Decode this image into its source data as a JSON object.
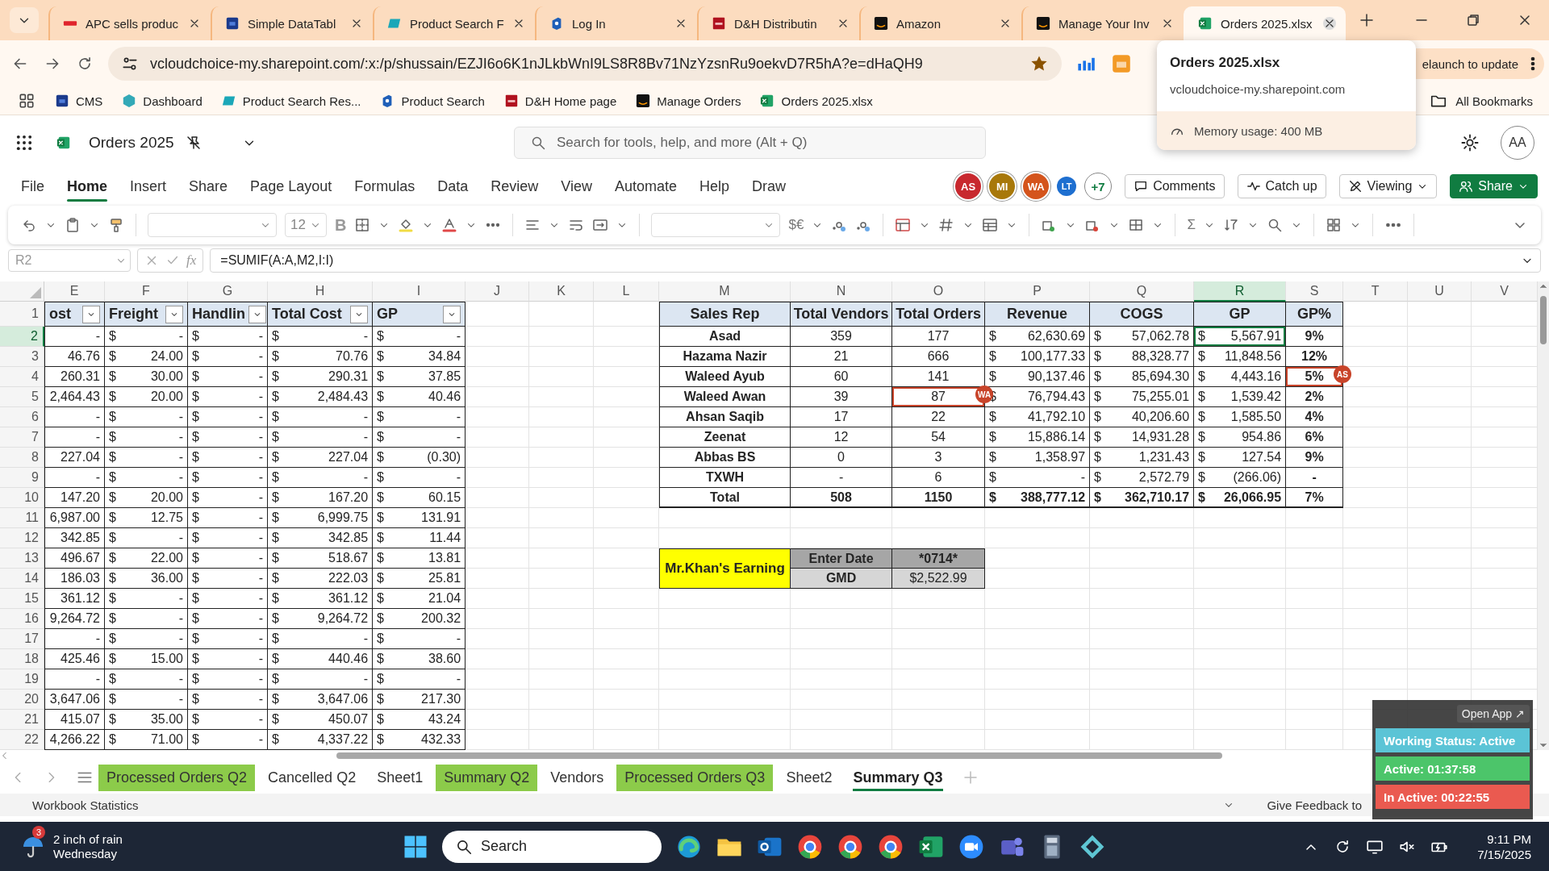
{
  "browser": {
    "tabs": [
      {
        "title": "APC sells produc",
        "selected": false
      },
      {
        "title": "Simple DataTabl",
        "selected": false
      },
      {
        "title": "Product Search F",
        "selected": false
      },
      {
        "title": "Log In",
        "selected": false
      },
      {
        "title": "D&H Distributin",
        "selected": false
      },
      {
        "title": "Amazon",
        "selected": false
      },
      {
        "title": "Manage Your Inv",
        "selected": false
      },
      {
        "title": "Orders 2025.xlsx",
        "selected": true
      }
    ],
    "address": "vcloudchoice-my.sharepoint.com/:x:/p/shussain/EZJI6o6K1nJLkbWnI9LS8R8Bv71NzYzsnRu9oekvD7R5hA?e=dHaQH9",
    "update_button": "elaunch to update",
    "bookmarks": [
      {
        "title": "CMS"
      },
      {
        "title": "Dashboard"
      },
      {
        "title": "Product Search Res..."
      },
      {
        "title": "Product Search"
      },
      {
        "title": "D&H Home page"
      },
      {
        "title": "Manage Orders"
      },
      {
        "title": "Orders 2025.xlsx"
      }
    ],
    "all_bookmarks": "All Bookmarks",
    "hover_card": {
      "title": "Orders 2025.xlsx",
      "host": "vcloudchoice-my.sharepoint.com",
      "memory": "Memory usage: 400 MB"
    }
  },
  "excel": {
    "doc_title": "Orders 2025",
    "search_placeholder": "Search for tools, help, and more (Alt + Q)",
    "account": "AA",
    "menu": [
      {
        "label": "File",
        "selected": false
      },
      {
        "label": "Home",
        "selected": true
      },
      {
        "label": "Insert",
        "selected": false
      },
      {
        "label": "Share",
        "selected": false
      },
      {
        "label": "Page Layout",
        "selected": false
      },
      {
        "label": "Formulas",
        "selected": false
      },
      {
        "label": "Data",
        "selected": false
      },
      {
        "label": "Review",
        "selected": false
      },
      {
        "label": "View",
        "selected": false
      },
      {
        "label": "Automate",
        "selected": false
      },
      {
        "label": "Help",
        "selected": false
      },
      {
        "label": "Draw",
        "selected": false
      }
    ],
    "collaborators": [
      {
        "initials": "AS",
        "color": "#c8282e"
      },
      {
        "initials": "MI",
        "color": "#a8780a"
      },
      {
        "initials": "WA",
        "color": "#d4541c"
      },
      {
        "initials": "LT",
        "color": "#1e6fd0"
      }
    ],
    "more_collaborators": "+7",
    "actions": [
      {
        "label": "Comments",
        "kind": "comments"
      },
      {
        "label": "Catch up",
        "kind": "catchup"
      },
      {
        "label": "Viewing",
        "kind": "viewing"
      },
      {
        "label": "Share",
        "kind": "share"
      }
    ],
    "ribbon": {
      "font_size": "12",
      "bold": "B",
      "currency": "$€",
      "sum": "Σ"
    },
    "name_box": "R2",
    "fx": "fx",
    "formula": "=SUMIF(A:A,M2,I:I)"
  },
  "sheet": {
    "columns": [
      {
        "label": "E",
        "selected": false
      },
      {
        "label": "F",
        "selected": false
      },
      {
        "label": "G",
        "selected": false
      },
      {
        "label": "H",
        "selected": false
      },
      {
        "label": "I",
        "selected": false
      },
      {
        "label": "J",
        "selected": false
      },
      {
        "label": "K",
        "selected": false
      },
      {
        "label": "L",
        "selected": false
      },
      {
        "label": "M",
        "selected": false
      },
      {
        "label": "N",
        "selected": false
      },
      {
        "label": "O",
        "selected": false
      },
      {
        "label": "P",
        "selected": false
      },
      {
        "label": "Q",
        "selected": false
      },
      {
        "label": "R",
        "selected": true
      },
      {
        "label": "S",
        "selected": false
      },
      {
        "label": "T",
        "selected": false
      },
      {
        "label": "U",
        "selected": false
      },
      {
        "label": "V",
        "selected": false
      }
    ],
    "rows": [
      {
        "label": "1",
        "selected": false
      },
      {
        "label": "2",
        "selected": true
      },
      {
        "label": "3",
        "selected": false
      },
      {
        "label": "4",
        "selected": false
      },
      {
        "label": "5",
        "selected": false
      },
      {
        "label": "6",
        "selected": false
      },
      {
        "label": "7",
        "selected": false
      },
      {
        "label": "8",
        "selected": false
      },
      {
        "label": "9",
        "selected": false
      },
      {
        "label": "10",
        "selected": false
      },
      {
        "label": "11",
        "selected": false
      },
      {
        "label": "12",
        "selected": false
      },
      {
        "label": "13",
        "selected": false
      },
      {
        "label": "14",
        "selected": false
      },
      {
        "label": "15",
        "selected": false
      },
      {
        "label": "16",
        "selected": false
      },
      {
        "label": "17",
        "selected": false
      },
      {
        "label": "18",
        "selected": false
      },
      {
        "label": "19",
        "selected": false
      },
      {
        "label": "20",
        "selected": false
      },
      {
        "label": "21",
        "selected": false
      },
      {
        "label": "22",
        "selected": false
      }
    ],
    "left_table": {
      "headers": [
        "ost",
        "Freight",
        "Handlin",
        "Total Cost",
        "GP"
      ],
      "rows": [
        [
          "-",
          [
            "$",
            "-"
          ],
          [
            "$",
            "-"
          ],
          [
            "$",
            "-"
          ],
          [
            "$",
            "-"
          ]
        ],
        [
          "46.76",
          [
            "$",
            "24.00"
          ],
          [
            "$",
            "-"
          ],
          [
            "$",
            "70.76"
          ],
          [
            "$",
            "34.84"
          ]
        ],
        [
          "260.31",
          [
            "$",
            "30.00"
          ],
          [
            "$",
            "-"
          ],
          [
            "$",
            "290.31"
          ],
          [
            "$",
            "37.85"
          ]
        ],
        [
          "2,464.43",
          [
            "$",
            "20.00"
          ],
          [
            "$",
            "-"
          ],
          [
            "$",
            "2,484.43"
          ],
          [
            "$",
            "40.46"
          ]
        ],
        [
          "-",
          [
            "$",
            "-"
          ],
          [
            "$",
            "-"
          ],
          [
            "$",
            "-"
          ],
          [
            "$",
            "-"
          ]
        ],
        [
          "-",
          [
            "$",
            "-"
          ],
          [
            "$",
            "-"
          ],
          [
            "$",
            "-"
          ],
          [
            "$",
            "-"
          ]
        ],
        [
          "227.04",
          [
            "$",
            "-"
          ],
          [
            "$",
            "-"
          ],
          [
            "$",
            "227.04"
          ],
          [
            "$",
            "(0.30)"
          ]
        ],
        [
          "-",
          [
            "$",
            "-"
          ],
          [
            "$",
            "-"
          ],
          [
            "$",
            "-"
          ],
          [
            "$",
            "-"
          ]
        ],
        [
          "147.20",
          [
            "$",
            "20.00"
          ],
          [
            "$",
            "-"
          ],
          [
            "$",
            "167.20"
          ],
          [
            "$",
            "60.15"
          ]
        ],
        [
          "6,987.00",
          [
            "$",
            "12.75"
          ],
          [
            "$",
            "-"
          ],
          [
            "$",
            "6,999.75"
          ],
          [
            "$",
            "131.91"
          ]
        ],
        [
          "342.85",
          [
            "$",
            "-"
          ],
          [
            "$",
            "-"
          ],
          [
            "$",
            "342.85"
          ],
          [
            "$",
            "11.44"
          ]
        ],
        [
          "496.67",
          [
            "$",
            "22.00"
          ],
          [
            "$",
            "-"
          ],
          [
            "$",
            "518.67"
          ],
          [
            "$",
            "13.81"
          ]
        ],
        [
          "186.03",
          [
            "$",
            "36.00"
          ],
          [
            "$",
            "-"
          ],
          [
            "$",
            "222.03"
          ],
          [
            "$",
            "25.81"
          ]
        ],
        [
          "361.12",
          [
            "$",
            "-"
          ],
          [
            "$",
            "-"
          ],
          [
            "$",
            "361.12"
          ],
          [
            "$",
            "21.04"
          ]
        ],
        [
          "9,264.72",
          [
            "$",
            "-"
          ],
          [
            "$",
            "-"
          ],
          [
            "$",
            "9,264.72"
          ],
          [
            "$",
            "200.32"
          ]
        ],
        [
          "-",
          [
            "$",
            "-"
          ],
          [
            "$",
            "-"
          ],
          [
            "$",
            "-"
          ],
          [
            "$",
            "-"
          ]
        ],
        [
          "425.46",
          [
            "$",
            "15.00"
          ],
          [
            "$",
            "-"
          ],
          [
            "$",
            "440.46"
          ],
          [
            "$",
            "38.60"
          ]
        ],
        [
          "-",
          [
            "$",
            "-"
          ],
          [
            "$",
            "-"
          ],
          [
            "$",
            "-"
          ],
          [
            "$",
            "-"
          ]
        ],
        [
          "3,647.06",
          [
            "$",
            "-"
          ],
          [
            "$",
            "-"
          ],
          [
            "$",
            "3,647.06"
          ],
          [
            "$",
            "217.30"
          ]
        ],
        [
          "415.07",
          [
            "$",
            "35.00"
          ],
          [
            "$",
            "-"
          ],
          [
            "$",
            "450.07"
          ],
          [
            "$",
            "43.24"
          ]
        ],
        [
          "4,266.22",
          [
            "$",
            "71.00"
          ],
          [
            "$",
            "-"
          ],
          [
            "$",
            "4,337.22"
          ],
          [
            "$",
            "432.33"
          ]
        ]
      ]
    },
    "summary_table": {
      "headers": [
        "Sales Rep",
        "Total Vendors",
        "Total Orders",
        "Revenue",
        "COGS",
        "GP",
        "GP%"
      ],
      "rows": [
        {
          "kind": "rep",
          "cells": [
            "Asad",
            "359",
            "177",
            [
              "$",
              "62,630.69"
            ],
            [
              "$",
              "57,062.78"
            ],
            [
              "$",
              "5,567.91"
            ],
            "9%"
          ]
        },
        {
          "kind": "rep",
          "cells": [
            "Hazama Nazir",
            "21",
            "666",
            [
              "$",
              "100,177.33"
            ],
            [
              "$",
              "88,328.77"
            ],
            [
              "$",
              "11,848.56"
            ],
            "12%"
          ]
        },
        {
          "kind": "rep",
          "cells": [
            "Waleed Ayub",
            "60",
            "141",
            [
              "$",
              "90,137.46"
            ],
            [
              "$",
              "85,694.30"
            ],
            [
              "$",
              "4,443.16"
            ],
            {
              "value": "5%",
              "marker": {
                "initials": "AS",
                "color": "#c8442a"
              }
            }
          ]
        },
        {
          "kind": "rep",
          "cells": [
            "Waleed Awan",
            "39",
            {
              "value": "87",
              "marker": {
                "initials": "WA",
                "color": "#c8442a"
              }
            },
            [
              "$",
              "76,794.43"
            ],
            [
              "$",
              "75,255.01"
            ],
            [
              "$",
              "1,539.42"
            ],
            "2%"
          ]
        },
        {
          "kind": "rep",
          "cells": [
            "Ahsan Saqib",
            "17",
            "22",
            [
              "$",
              "41,792.10"
            ],
            [
              "$",
              "40,206.60"
            ],
            [
              "$",
              "1,585.50"
            ],
            "4%"
          ]
        },
        {
          "kind": "rep",
          "cells": [
            "Zeenat",
            "12",
            "54",
            [
              "$",
              "15,886.14"
            ],
            [
              "$",
              "14,931.28"
            ],
            [
              "$",
              "954.86"
            ],
            "6%"
          ]
        },
        {
          "kind": "rep",
          "cells": [
            "Abbas BS",
            "0",
            "3",
            [
              "$",
              "1,358.97"
            ],
            [
              "$",
              "1,231.43"
            ],
            [
              "$",
              "127.54"
            ],
            "9%"
          ]
        },
        {
          "kind": "rep",
          "cells": [
            "TXWH",
            "-",
            "6",
            [
              "$",
              "-"
            ],
            [
              "$",
              "2,572.79"
            ],
            [
              "$",
              "(266.06)"
            ],
            "-"
          ]
        },
        {
          "kind": "total",
          "cells": [
            "Total",
            "508",
            "1150",
            [
              "$",
              "388,777.12"
            ],
            [
              "$",
              "362,710.17"
            ],
            [
              "$",
              "26,066.95"
            ],
            "7%"
          ]
        }
      ]
    },
    "earning_box": {
      "label": "Mr.Khan's Earning",
      "rows": [
        {
          "label": "Enter Date",
          "value": "*0714*"
        },
        {
          "label": "GMD",
          "value": "$2,522.99"
        }
      ]
    }
  },
  "sheet_tabs": [
    {
      "label": "Processed Orders Q2",
      "filled": true,
      "selected": false
    },
    {
      "label": "Cancelled Q2",
      "filled": false,
      "selected": false
    },
    {
      "label": "Sheet1",
      "filled": false,
      "selected": false
    },
    {
      "label": "Summary Q2",
      "filled": true,
      "selected": false
    },
    {
      "label": "Vendors",
      "filled": false,
      "selected": false
    },
    {
      "label": "Processed Orders Q3",
      "filled": true,
      "selected": false
    },
    {
      "label": "Sheet2",
      "filled": false,
      "selected": false
    },
    {
      "label": "Summary Q3",
      "filled": false,
      "selected": true
    }
  ],
  "status_bar": {
    "statistics": "Workbook Statistics",
    "feedback": "Give Feedback to"
  },
  "tracker": {
    "open_app": "Open App ↗",
    "lines": [
      {
        "text": "Working Status: Active",
        "color": "#5bc4d6"
      },
      {
        "text": "Active: 01:37:58",
        "color": "#4cc56a"
      },
      {
        "text": "In Active: 00:22:55",
        "color": "#ea5a50"
      }
    ]
  },
  "taskbar": {
    "badge": "3",
    "weather": "2 inch of rain",
    "day": "Wednesday",
    "search": "Search",
    "time": "9:11 PM",
    "date": "7/15/2025"
  }
}
